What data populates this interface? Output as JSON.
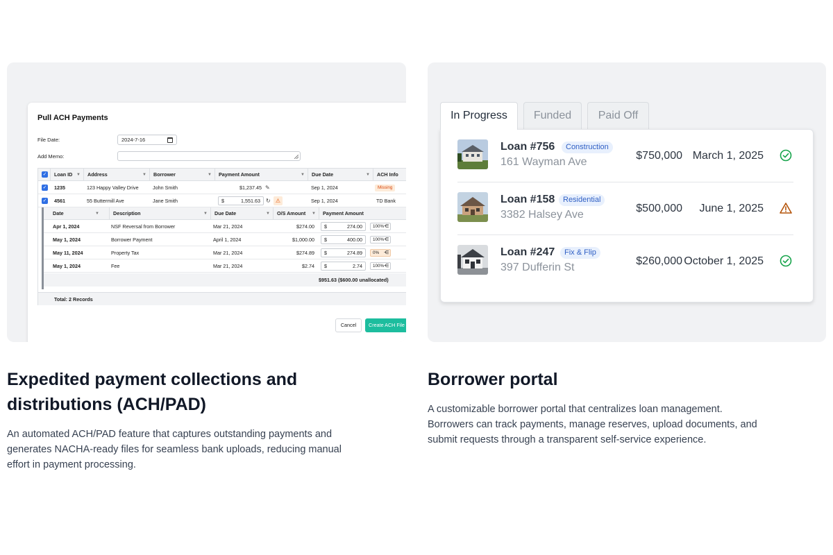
{
  "ach": {
    "title": "Pull ACH Payments",
    "file_date_label": "File Date:",
    "file_date_value": "2024-7-16",
    "add_memo_label": "Add Memo:",
    "columns": [
      "Loan ID",
      "Address",
      "Borrower",
      "Payment Amount",
      "Due Date",
      "ACH Info"
    ],
    "rows": [
      {
        "loan_id": "1235",
        "address": "123 Happy Valley Drive",
        "borrower": "John Smith",
        "payment": "$1,237.45",
        "due": "Sep 1, 2024",
        "ach": "Missing"
      },
      {
        "loan_id": "4561",
        "address": "55 Buttermill Ave",
        "borrower": "Jane Smith",
        "payment_symbol": "$",
        "payment": "1,551.63",
        "due": "Sep 1, 2024",
        "ach": "TD Bank"
      }
    ],
    "sub_columns": [
      "Date",
      "Description",
      "Due Date",
      "O/S Amount",
      "Payment Amount"
    ],
    "sub_rows": [
      {
        "date": "Apr 1, 2024",
        "description": "NSF Reversal from Borrower",
        "due": "Mar 21, 2024",
        "os": "$274.00",
        "symbol": "$",
        "amount": "274.00",
        "pct": "100%"
      },
      {
        "date": "May 1, 2024",
        "description": "Borrower Payment",
        "due": "April 1, 2024",
        "os": "$1,000.00",
        "symbol": "$",
        "amount": "400.00",
        "pct": "100%"
      },
      {
        "date": "May 11, 2024",
        "description": "Property Tax",
        "due": "Mar 21, 2024",
        "os": "$274.89",
        "symbol": "$",
        "amount": "274.89",
        "pct": "0%"
      },
      {
        "date": "May 1, 2024",
        "description": "Fee",
        "due": "Mar 21, 2024",
        "os": "$2.74",
        "symbol": "$",
        "amount": "2.74",
        "pct": "100%"
      }
    ],
    "sub_total": "$951.63 ($600.00 unallocated)",
    "footer_total": "Total: 2 Records",
    "cancel_label": "Cancel",
    "create_label": "Create ACH File"
  },
  "portal": {
    "tabs": [
      "In Progress",
      "Funded",
      "Paid Off"
    ],
    "active_tab": "In Progress",
    "loans": [
      {
        "name": "Loan #756",
        "tag": "Construction",
        "address": "161 Wayman Ave",
        "amount": "$750,000",
        "date": "March 1, 2025",
        "status": "check-icon"
      },
      {
        "name": "Loan #158",
        "tag": "Residential",
        "address": "3382 Halsey Ave",
        "amount": "$500,000",
        "date": "June 1, 2025",
        "status": "warning-icon"
      },
      {
        "name": "Loan #247",
        "tag": "Fix & Flip",
        "address": "397 Dufferin St",
        "amount": "$260,000",
        "date": "October 1, 2025",
        "status": "check-icon"
      }
    ],
    "colors": {
      "check": "#16a34a",
      "warning": "#b45309",
      "tag_bg": "#e8f0fd",
      "tag_text": "#2f5fc4"
    }
  },
  "features": {
    "left_title": "Expedited payment collections and distributions (ACH/PAD)",
    "left_desc": "An automated ACH/PAD feature that captures outstanding payments and generates NACHA-ready files for seamless bank uploads, reducing manual effort in payment processing.",
    "right_title": "Borrower portal",
    "right_desc": "A customizable borrower portal that centralizes loan management. Borrowers can track payments, manage reserves, upload documents, and submit requests through a transparent self-service experience."
  },
  "colors": {
    "accent_green": "#1dbd9e",
    "checkbox_blue": "#2f6fe4",
    "card_bg": "#f1f2f4"
  }
}
